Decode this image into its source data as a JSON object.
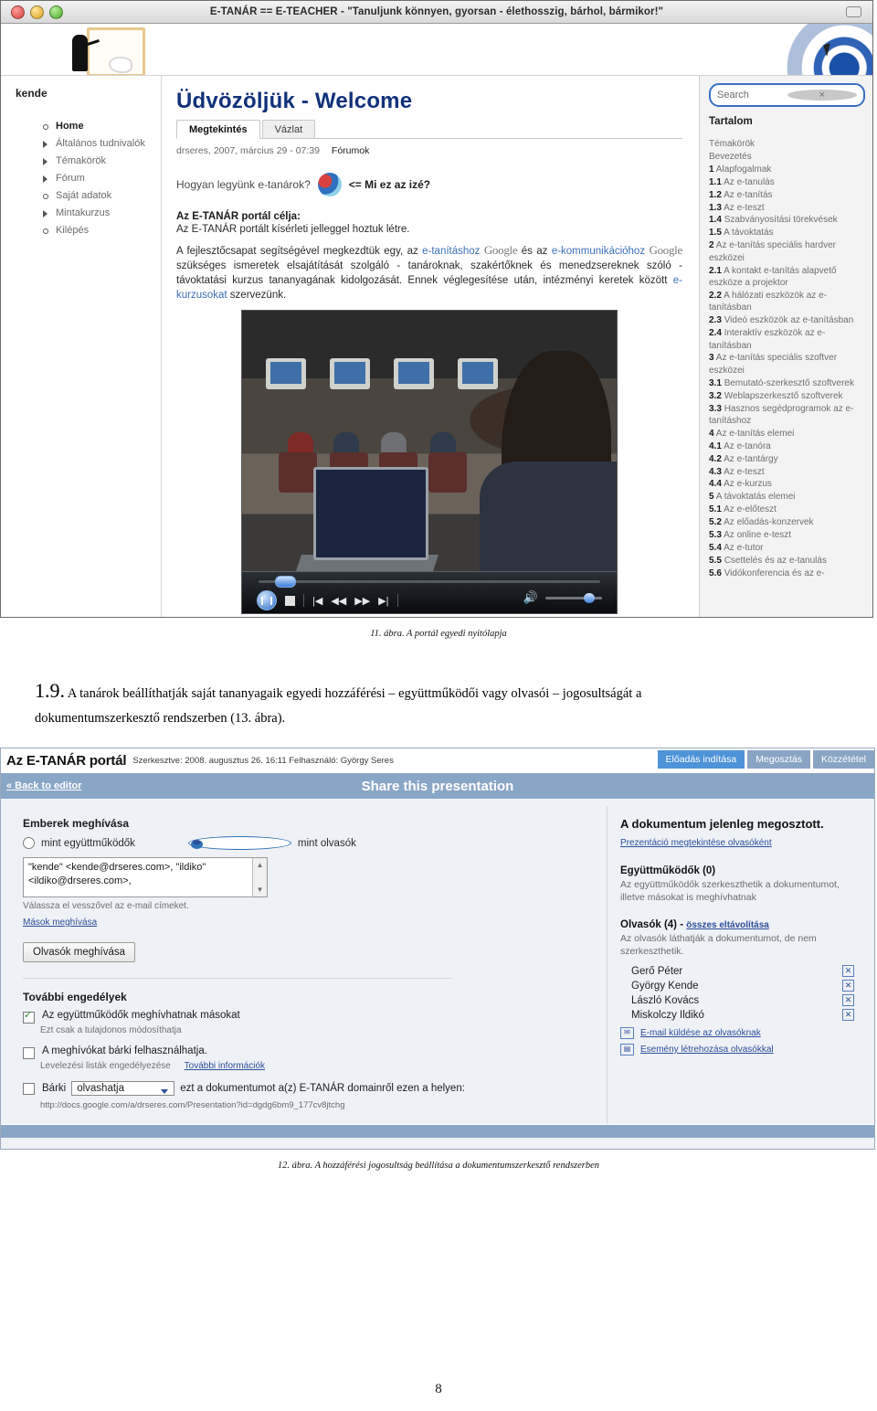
{
  "figure1": {
    "window_title": "E-TANÁR == E-TEACHER - \"Tanuljunk könnyen, gyorsan - élethosszig, bárhol, bármikor!\"",
    "user_label": "kende",
    "nav_items": [
      {
        "label": "Home",
        "bullet": "circle",
        "active": true
      },
      {
        "label": "Általános tudnivalók",
        "bullet": "triangle",
        "active": false
      },
      {
        "label": "Témakörök",
        "bullet": "triangle",
        "active": false
      },
      {
        "label": "Fórum",
        "bullet": "triangle",
        "active": false
      },
      {
        "label": "Saját adatok",
        "bullet": "circle",
        "active": false
      },
      {
        "label": "Mintakurzus",
        "bullet": "triangle",
        "active": false
      },
      {
        "label": "Kilépés",
        "bullet": "circle",
        "active": false
      }
    ],
    "page_title": "Üdvözöljük - Welcome",
    "tabs": [
      {
        "label": "Megtekintés",
        "active": true
      },
      {
        "label": "Vázlat",
        "active": false
      }
    ],
    "meta_author": "drseres, 2007, március 29 - 07:39",
    "meta_forum": "Fórumok",
    "how_question": "Hogyan legyünk e-tanárok?",
    "how_whatsthis": "<= Mi ez az izé?",
    "goal_heading": "Az E-TANÁR portál célja:",
    "goal_sub": "Az E-TANÁR portált kísérleti jelleggel hoztuk létre.",
    "paragraph_parts": {
      "p1": "A fejlesztőcsapat segítségével megkezdtük egy, az ",
      "link1": "e-tanításhoz",
      "google1": "Google",
      "p2": " és az ",
      "link2": "e-kommunikációhoz",
      "google2": "Google",
      "p3": " szükséges ismeretek elsajátítását szolgáló - tanároknak, szakértőknek és menedzsereknek szóló - távoktatási kurzus tananyagának kidolgozását. Ennek véglegesítése után, intézményi keretek között ",
      "link3": "e-kurzusokat",
      "p4": " szervezünk."
    },
    "video": {
      "play_icon": "pause-icon",
      "stop_icon": "stop-icon",
      "prev_icon": "skip-back-icon",
      "rewind_icon": "rewind-icon",
      "forward_icon": "fast-forward-icon",
      "next_icon": "skip-forward-icon",
      "volume_icon": "volume-icon"
    },
    "search_placeholder": "Search",
    "toc_heading": "Tartalom",
    "toc_items": [
      {
        "num": "",
        "text": "Témakörök"
      },
      {
        "num": "",
        "text": "Bevezetés"
      },
      {
        "num": "1",
        "text": "Alapfogalmak"
      },
      {
        "num": "1.1",
        "text": "Az e-tanulás"
      },
      {
        "num": "1.2",
        "text": "Az e-tanítás"
      },
      {
        "num": "1.3",
        "text": "Az e-teszt"
      },
      {
        "num": "1.4",
        "text": "Szabványosítási törekvések"
      },
      {
        "num": "1.5",
        "text": "A távoktatás"
      },
      {
        "num": "2",
        "text": "Az e-tanítás speciális hardver eszközei"
      },
      {
        "num": "2.1",
        "text": "A kontakt e-tanítás alapvető eszköze a projektor"
      },
      {
        "num": "2.2",
        "text": "A hálózati eszközök az e-tanításban"
      },
      {
        "num": "2.3",
        "text": "Videó eszközök az e-tanításban"
      },
      {
        "num": "2.4",
        "text": "Interaktív eszközök az e-tanításban"
      },
      {
        "num": "3",
        "text": "Az e-tanítás speciális szoftver eszközei"
      },
      {
        "num": "3.1",
        "text": "Bemutató-szerkesztő szoftverek"
      },
      {
        "num": "3.2",
        "text": "Weblapszerkesztő szoftverek"
      },
      {
        "num": "3.3",
        "text": "Hasznos segédprogramok az e-tanításhoz"
      },
      {
        "num": "4",
        "text": "Az e-tanítás elemei"
      },
      {
        "num": "4.1",
        "text": "Az e-tanóra"
      },
      {
        "num": "4.2",
        "text": "Az e-tantárgy"
      },
      {
        "num": "4.3",
        "text": "Az e-teszt"
      },
      {
        "num": "4.4",
        "text": "Az e-kurzus"
      },
      {
        "num": "5",
        "text": "A távoktatás elemei"
      },
      {
        "num": "5.1",
        "text": "Az e-előteszt"
      },
      {
        "num": "5.2",
        "text": "Az előadás-konzervek"
      },
      {
        "num": "5.3",
        "text": "Az online e-teszt"
      },
      {
        "num": "5.4",
        "text": "Az e-tutor"
      },
      {
        "num": "5.5",
        "text": "Csettelés és az e-tanulás"
      },
      {
        "num": "5.6",
        "text": "Vidókonferencia és az e-"
      }
    ]
  },
  "caption1": "11. ábra. A portál egyedi nyitólapja",
  "body_paragraph": {
    "number": "1.9.",
    "line1": "A tanárok beállíthatják saját tananyagaik egyedi hozzáférési – együttműködői vagy olvasói – jogosultságát a",
    "line2": "dokumentumszerkesztő rendszerben (13. ábra)."
  },
  "figure2": {
    "brand": "Az E-TANÁR portál",
    "meta": "Szerkesztve: 2008. augusztus 26. 16:11 Felhasználó: György Seres",
    "top_buttons": [
      {
        "label": "Előadás indítása",
        "primary": true
      },
      {
        "label": "Megosztás",
        "primary": false
      },
      {
        "label": "Közzététel",
        "primary": false
      }
    ],
    "back_link": "« Back to editor",
    "bar_title": "Share this presentation",
    "left": {
      "invite_heading": "Emberek meghívása",
      "radio_collab": "mint együttműködők",
      "radio_reader": "mint olvasók",
      "selected_radio": "mint olvasók",
      "emails_value": "\"kende\" <kende@drseres.com>, \"ildiko\" <ildiko@drseres.com>,",
      "emails_hint": "Válassza el vesszővel az e-mail címeket.",
      "invite_others_link": "Mások meghívása",
      "invite_button": "Olvasók meghívása",
      "perm_heading": "További engedélyek",
      "perm1_label": "Az együttműködők meghívhatnak másokat",
      "perm1_sub": "Ezt csak a tulajdonos módosíthatja",
      "perm1_checked": true,
      "perm2_label": "A meghívókat bárki felhasználhatja.",
      "perm2_sub": "Levelezési listák engedélyezése",
      "perm2_link": "További információk",
      "perm2_checked": false,
      "perm3_prefix": "Bárki",
      "perm3_select": "olvashatja",
      "perm3_suffix": "ezt a dokumentumot a(z) E-TANÁR domainről ezen a helyen:",
      "perm3_checked": false,
      "doc_url": "http://docs.google.com/a/drseres.com/Presentation?id=dgdg6bm9_177cv8jtchg"
    },
    "right": {
      "shared_heading": "A dokumentum jelenleg megosztott.",
      "view_link": "Prezentáció megtekintése olvasóként",
      "collab_heading": "Együttműködők (0)",
      "collab_desc": "Az együttműködők szerkeszthetik a dokumentumot, illetve másokat is meghívhatnak",
      "readers_heading": "Olvasók (4) -",
      "readers_remove_link": "összes eltávolítása",
      "readers_desc": "Az olvasók láthatják a dokumentumot, de nem szerkeszthetik.",
      "readers": [
        "Gerő Péter",
        "György Kende",
        "László Kovács",
        "Miskolczy Ildikó"
      ],
      "action_email": "E-mail küldése az olvasóknak",
      "action_event": "Esemény létrehozása olvasókkal"
    }
  },
  "caption2": "12. ábra. A hozzáférési jogosultság beállítása a dokumentumszerkesztő rendszerben",
  "page_number": "8"
}
